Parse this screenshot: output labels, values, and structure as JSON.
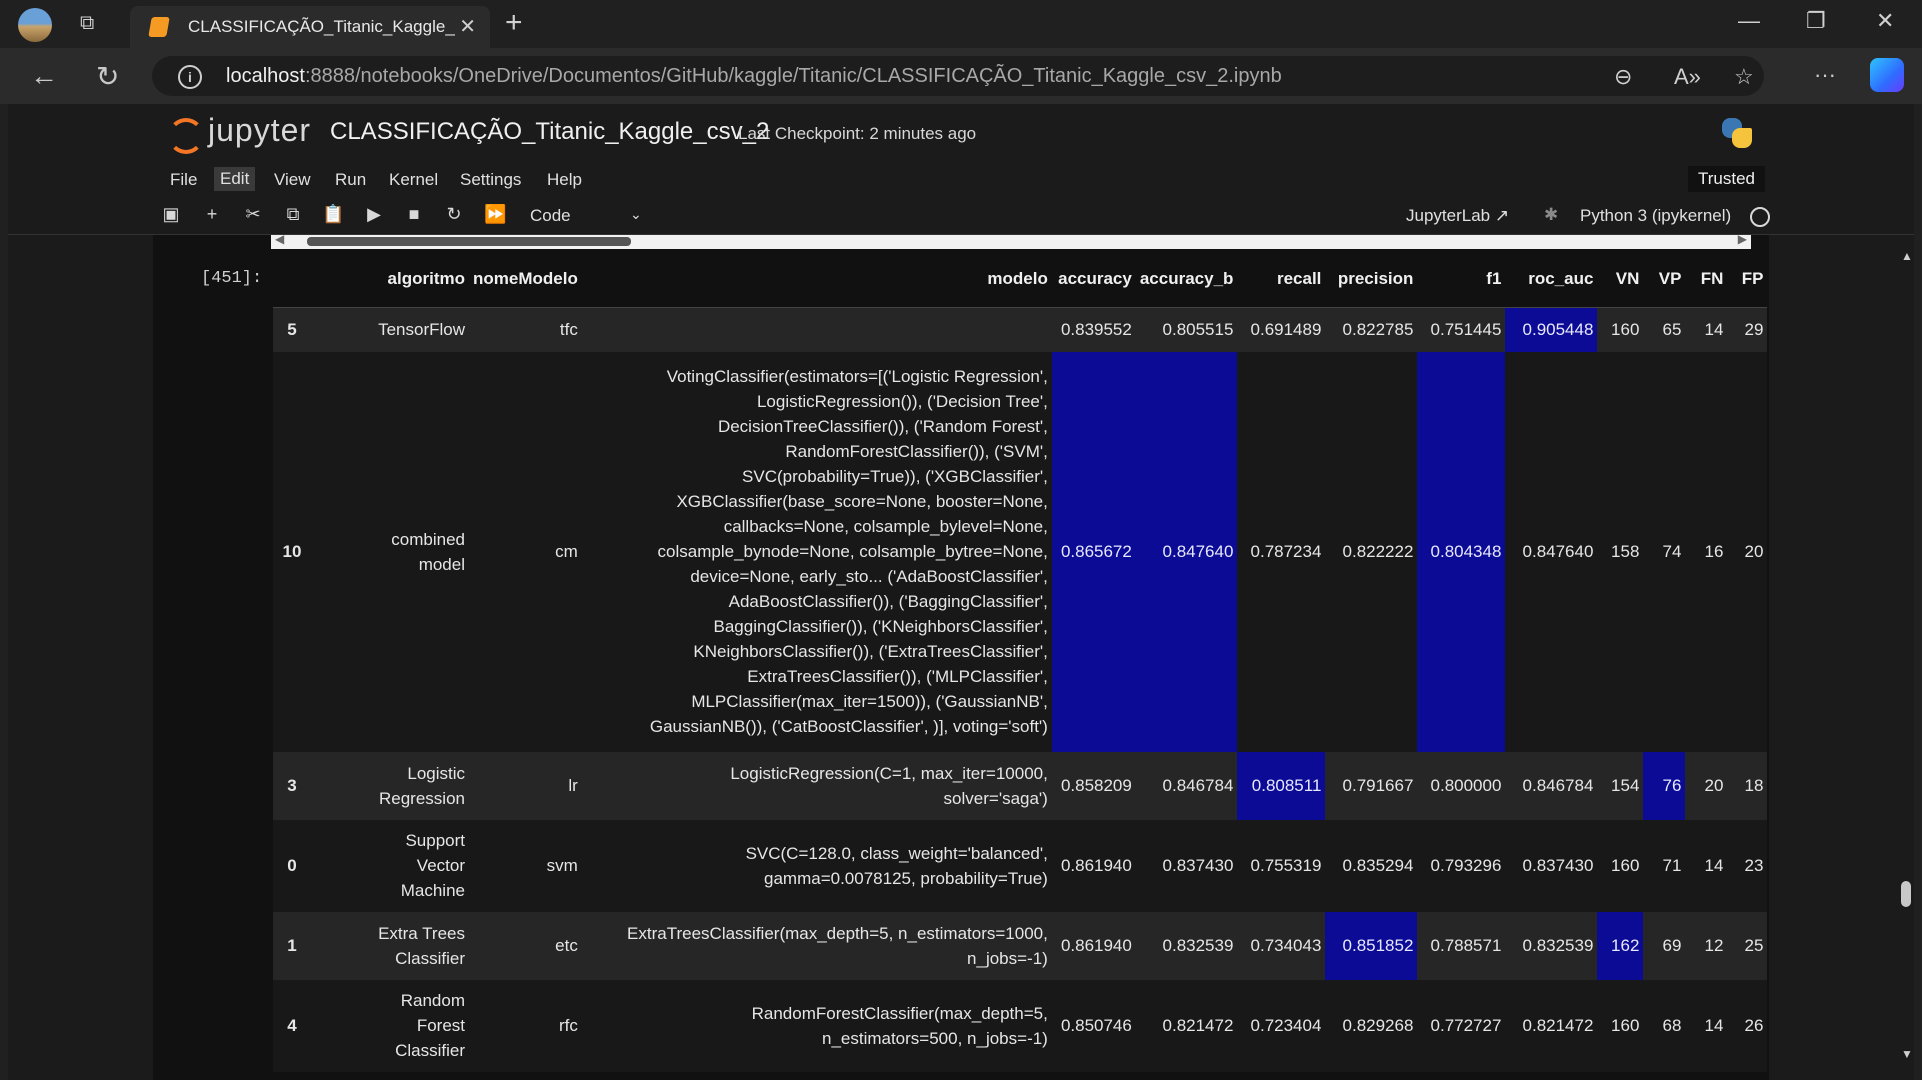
{
  "browser": {
    "tab_title": "CLASSIFICAÇÃO_Titanic_Kaggle_",
    "url_host": "localhost",
    "url_path": ":8888/notebooks/OneDrive/Documentos/GitHub/kaggle/Titanic/CLASSIFICAÇÃO_Titanic_Kaggle_csv_2.ipynb",
    "icons": [
      "back-icon",
      "refresh-icon",
      "info-icon",
      "zoom-out-icon",
      "read-aloud-icon",
      "favorite-icon",
      "more-icon",
      "copilot-icon"
    ]
  },
  "jupyter": {
    "logo_text": "jupyter",
    "notebook_name": "CLASSIFICAÇÃO_Titanic_Kaggle_csv_2",
    "checkpoint": "Last Checkpoint: 2 minutes ago",
    "menu": [
      "File",
      "Edit",
      "View",
      "Run",
      "Kernel",
      "Settings",
      "Help"
    ],
    "active_menu": "Edit",
    "trusted": "Trusted",
    "cell_type": "Code",
    "jupyterlab_link": "JupyterLab",
    "kernel": "Python 3 (ipykernel)"
  },
  "output": {
    "prompt": "[451]:",
    "columns": [
      "",
      "algoritmo",
      "nomeModelo",
      "modelo",
      "accuracy",
      "accuracy_b",
      "recall",
      "precision",
      "f1",
      "roc_auc",
      "VN",
      "VP",
      "FN",
      "FP"
    ],
    "highlight_color": "#0b0b96",
    "rows": [
      {
        "index": "5",
        "algoritmo": [
          "TensorFlow"
        ],
        "nomeModelo": "tfc",
        "modelo": [
          ""
        ],
        "accuracy": "0.839552",
        "accuracy_b": "0.805515",
        "recall": "0.691489",
        "precision": "0.822785",
        "f1": "0.751445",
        "roc_auc": "0.905448",
        "VN": "160",
        "VP": "65",
        "FN": "14",
        "FP": "29",
        "highlight": [
          "roc_auc"
        ]
      },
      {
        "index": "10",
        "algoritmo": [
          "combined",
          "model"
        ],
        "nomeModelo": "cm",
        "modelo": [
          "VotingClassifier(estimators=[('Logistic Regression',",
          "LogisticRegression()), ('Decision Tree',",
          "DecisionTreeClassifier()), ('Random Forest',",
          "RandomForestClassifier()), ('SVM',",
          "SVC(probability=True)), ('XGBClassifier',",
          "XGBClassifier(base_score=None, booster=None,",
          "callbacks=None, colsample_bylevel=None,",
          "colsample_bynode=None, colsample_bytree=None,",
          "device=None, early_sto... ('AdaBoostClassifier',",
          "AdaBoostClassifier()), ('BaggingClassifier',",
          "BaggingClassifier()), ('KNeighborsClassifier',",
          "KNeighborsClassifier()), ('ExtraTreesClassifier',",
          "ExtraTreesClassifier()), ('MLPClassifier',",
          "MLPClassifier(max_iter=1500)), ('GaussianNB',",
          "GaussianNB()), ('CatBoostClassifier', )], voting='soft')"
        ],
        "accuracy": "0.865672",
        "accuracy_b": "0.847640",
        "recall": "0.787234",
        "precision": "0.822222",
        "f1": "0.804348",
        "roc_auc": "0.847640",
        "VN": "158",
        "VP": "74",
        "FN": "16",
        "FP": "20",
        "highlight": [
          "accuracy",
          "accuracy_b",
          "f1"
        ]
      },
      {
        "index": "3",
        "algoritmo": [
          "Logistic",
          "Regression"
        ],
        "nomeModelo": "lr",
        "modelo": [
          "LogisticRegression(C=1, max_iter=10000,",
          "solver='saga')"
        ],
        "accuracy": "0.858209",
        "accuracy_b": "0.846784",
        "recall": "0.808511",
        "precision": "0.791667",
        "f1": "0.800000",
        "roc_auc": "0.846784",
        "VN": "154",
        "VP": "76",
        "FN": "20",
        "FP": "18",
        "highlight": [
          "recall",
          "VP"
        ]
      },
      {
        "index": "0",
        "algoritmo": [
          "Support",
          "Vector",
          "Machine"
        ],
        "nomeModelo": "svm",
        "modelo": [
          "SVC(C=128.0, class_weight='balanced',",
          "gamma=0.0078125, probability=True)"
        ],
        "accuracy": "0.861940",
        "accuracy_b": "0.837430",
        "recall": "0.755319",
        "precision": "0.835294",
        "f1": "0.793296",
        "roc_auc": "0.837430",
        "VN": "160",
        "VP": "71",
        "FN": "14",
        "FP": "23",
        "highlight": []
      },
      {
        "index": "1",
        "algoritmo": [
          "Extra Trees",
          "Classifier"
        ],
        "nomeModelo": "etc",
        "modelo": [
          "ExtraTreesClassifier(max_depth=5, n_estimators=1000,",
          "n_jobs=-1)"
        ],
        "accuracy": "0.861940",
        "accuracy_b": "0.832539",
        "recall": "0.734043",
        "precision": "0.851852",
        "f1": "0.788571",
        "roc_auc": "0.832539",
        "VN": "162",
        "VP": "69",
        "FN": "12",
        "FP": "25",
        "highlight": [
          "precision",
          "VN"
        ]
      },
      {
        "index": "4",
        "algoritmo": [
          "Random",
          "Forest",
          "Classifier"
        ],
        "nomeModelo": "rfc",
        "modelo": [
          "RandomForestClassifier(max_depth=5,",
          "n_estimators=500, n_jobs=-1)"
        ],
        "accuracy": "0.850746",
        "accuracy_b": "0.821472",
        "recall": "0.723404",
        "precision": "0.829268",
        "f1": "0.772727",
        "roc_auc": "0.821472",
        "VN": "160",
        "VP": "68",
        "FN": "14",
        "FP": "26",
        "highlight": []
      }
    ]
  }
}
